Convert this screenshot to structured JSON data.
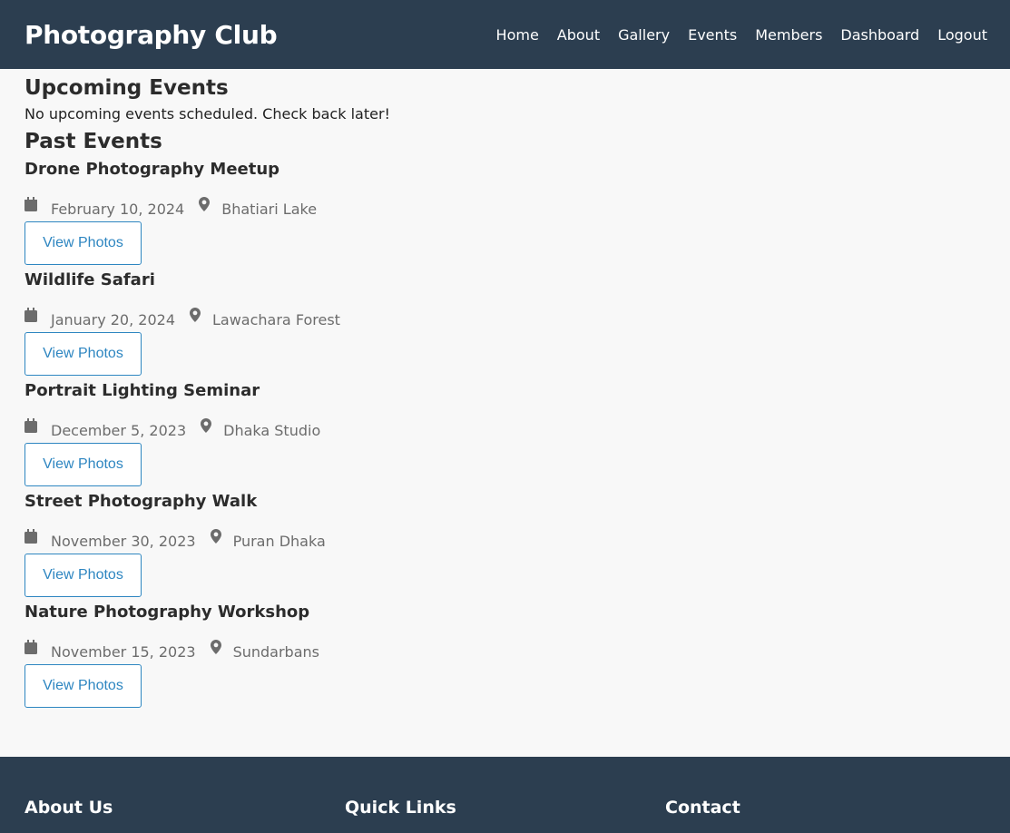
{
  "header": {
    "brand": "Photography Club",
    "nav": [
      "Home",
      "About",
      "Gallery",
      "Events",
      "Members",
      "Dashboard",
      "Logout"
    ]
  },
  "upcoming": {
    "heading": "Upcoming Events",
    "empty_message": "No upcoming events scheduled. Check back later!"
  },
  "past": {
    "heading": "Past Events",
    "button_label": "View Photos",
    "events": [
      {
        "title": "Drone Photography Meetup",
        "date": "February 10, 2024",
        "location": "Bhatiari Lake"
      },
      {
        "title": "Wildlife Safari",
        "date": "January 20, 2024",
        "location": "Lawachara Forest"
      },
      {
        "title": "Portrait Lighting Seminar",
        "date": "December 5, 2023",
        "location": "Dhaka Studio"
      },
      {
        "title": "Street Photography Walk",
        "date": "November 30, 2023",
        "location": "Puran Dhaka"
      },
      {
        "title": "Nature Photography Workshop",
        "date": "November 15, 2023",
        "location": "Sundarbans"
      }
    ]
  },
  "footer": {
    "columns": [
      "About Us",
      "Quick Links",
      "Contact"
    ]
  },
  "colors": {
    "header_bg": "#2c3e50",
    "accent": "#2e86c1",
    "muted": "#6c6c6c"
  },
  "icons": {
    "date": "calendar-icon",
    "location": "map-marker-icon"
  }
}
